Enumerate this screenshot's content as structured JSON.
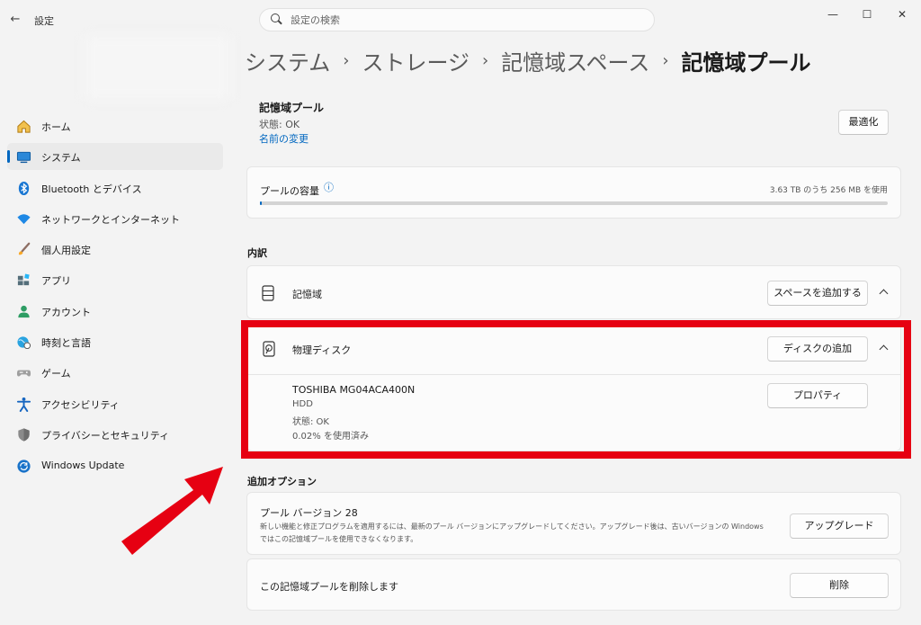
{
  "window": {
    "app_title": "設定",
    "back_glyph": "←",
    "minimize_glyph": "—",
    "maximize_glyph": "☐",
    "close_glyph": "✕"
  },
  "search": {
    "placeholder": "設定の検索"
  },
  "sidebar": {
    "items": [
      {
        "label": "ホーム",
        "icon": "home-icon"
      },
      {
        "label": "システム",
        "icon": "system-icon",
        "active": true
      },
      {
        "label": "Bluetooth とデバイス",
        "icon": "bluetooth-icon"
      },
      {
        "label": "ネットワークとインターネット",
        "icon": "wifi-icon"
      },
      {
        "label": "個人用設定",
        "icon": "brush-icon"
      },
      {
        "label": "アプリ",
        "icon": "apps-icon"
      },
      {
        "label": "アカウント",
        "icon": "account-icon"
      },
      {
        "label": "時刻と言語",
        "icon": "globe-clock-icon"
      },
      {
        "label": "ゲーム",
        "icon": "gamepad-icon"
      },
      {
        "label": "アクセシビリティ",
        "icon": "accessibility-icon"
      },
      {
        "label": "プライバシーとセキュリティ",
        "icon": "shield-icon"
      },
      {
        "label": "Windows Update",
        "icon": "windows-update-icon"
      }
    ]
  },
  "breadcrumb": {
    "items": [
      "システム",
      "ストレージ",
      "記憶域スペース",
      "記憶域プール"
    ],
    "separator": "›"
  },
  "pool_header": {
    "title": "記憶域プール",
    "status": "状態: OK",
    "rename_link": "名前の変更",
    "optimize_button": "最適化"
  },
  "capacity": {
    "label": "プールの容量",
    "info_glyph": "ⓘ",
    "usage_text": "3.63 TB のうち 256 MB を使用",
    "used_fraction": 0.0001
  },
  "breakdown": {
    "section_title": "内訳",
    "storage": {
      "label": "記憶域",
      "add_space_button": "スペースを追加する"
    },
    "physical": {
      "label": "物理ディスク",
      "add_disk_button": "ディスクの追加",
      "disk": {
        "name": "TOSHIBA MG04ACA400N",
        "type": "HDD",
        "status": "状態: OK",
        "usage": "0.02% を使用済み",
        "properties_button": "プロパティ"
      }
    }
  },
  "additional": {
    "section_title": "追加オプション",
    "upgrade": {
      "title": "プール バージョン 28",
      "description_line1": "新しい機能と修正プログラムを適用するには、最新のプール バージョンにアップグレードしてください。アップグレード後は、古いバージョンの Windows",
      "description_line2": "ではこの記憶域プールを使用できなくなります。",
      "button": "アップグレード"
    },
    "delete": {
      "label": "この記憶域プールを削除します",
      "button": "削除"
    }
  },
  "colors": {
    "accent": "#0067c0",
    "highlight": "#e60012"
  }
}
